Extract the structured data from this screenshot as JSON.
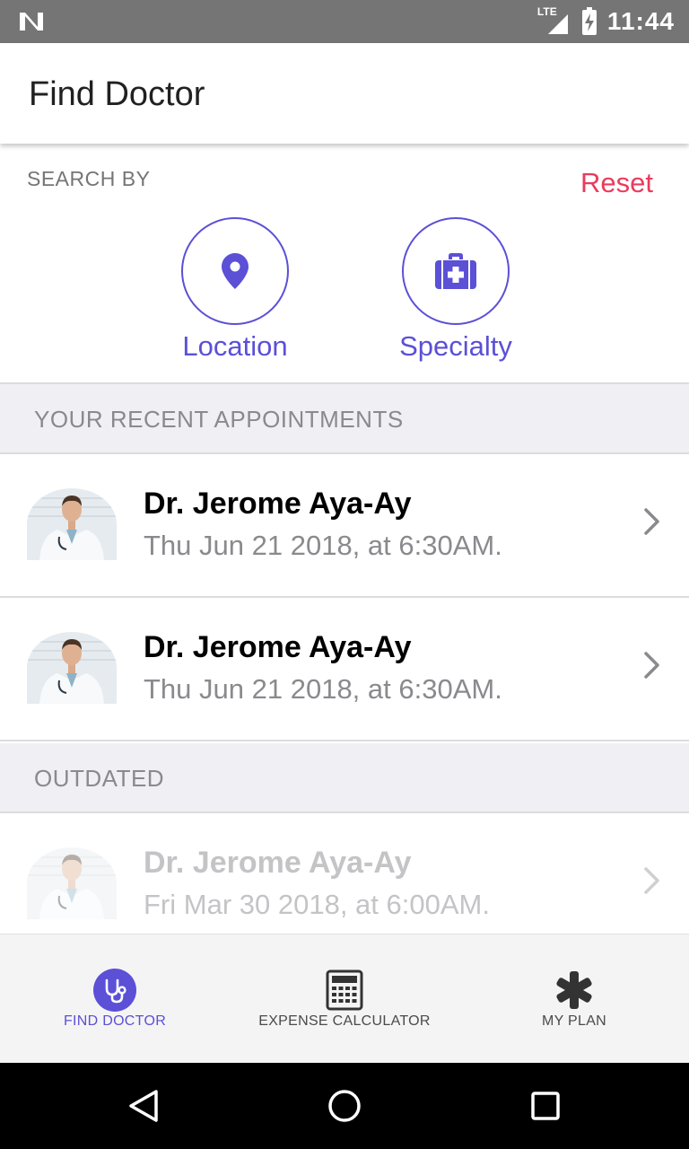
{
  "status_bar": {
    "time": "11:44",
    "network": "LTE"
  },
  "app_bar": {
    "title": "Find Doctor"
  },
  "search": {
    "label": "SEARCH BY",
    "reset_label": "Reset",
    "options": [
      {
        "label": "Location",
        "icon": "map-pin-icon"
      },
      {
        "label": "Specialty",
        "icon": "medical-kit-icon"
      }
    ]
  },
  "recent": {
    "header": "YOUR RECENT APPOINTMENTS",
    "items": [
      {
        "name": "Dr. Jerome Aya-Ay",
        "date": "Thu Jun 21 2018, at 6:30AM."
      },
      {
        "name": "Dr. Jerome Aya-Ay",
        "date": "Thu Jun 21 2018, at 6:30AM."
      }
    ]
  },
  "outdated": {
    "header": "OUTDATED",
    "items": [
      {
        "name": "Dr. Jerome Aya-Ay",
        "date": "Fri Mar 30 2018, at 6:00AM."
      }
    ]
  },
  "bottom_nav": {
    "items": [
      {
        "label": "FIND DOCTOR",
        "icon": "stethoscope-icon",
        "active": true
      },
      {
        "label": "EXPENSE CALCULATOR",
        "icon": "calculator-icon",
        "active": false
      },
      {
        "label": "MY PLAN",
        "icon": "asterisk-icon",
        "active": false
      }
    ]
  },
  "colors": {
    "accent": "#5b50d6",
    "reset": "#ea3b5e",
    "status_bar": "#757575",
    "section_bg": "#efeff4"
  }
}
